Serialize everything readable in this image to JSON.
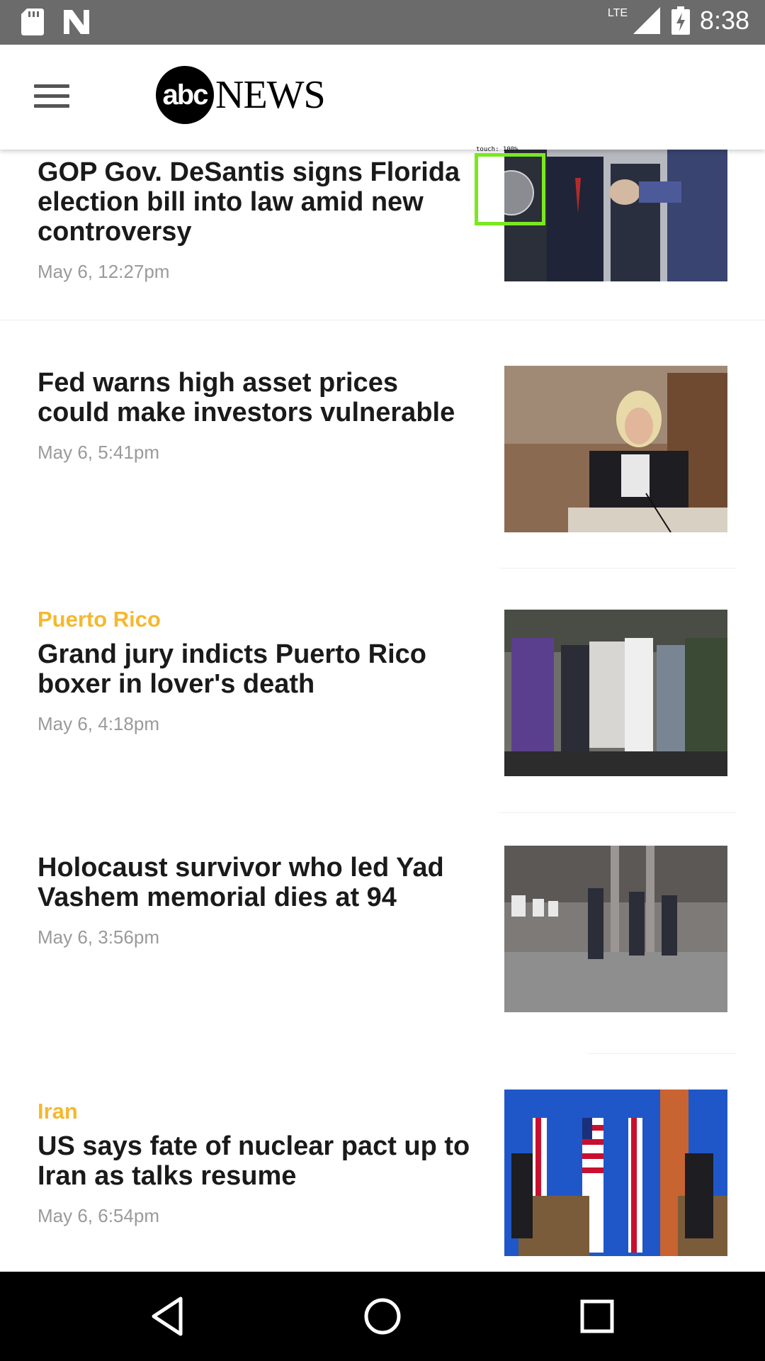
{
  "status_bar": {
    "time": "8:38",
    "network": "LTE",
    "icons": [
      "sd-card-icon",
      "n-logo-icon",
      "signal-icon",
      "battery-charging-icon"
    ]
  },
  "app_bar": {
    "logo_circle": "abc",
    "logo_word": "NEWS",
    "menu_icon": "hamburger-menu-icon"
  },
  "touch_indicator": {
    "label": "touch: 100%"
  },
  "articles": [
    {
      "category": "",
      "headline": "GOP Gov. DeSantis signs Florida election bill into law amid new controversy",
      "date": "May 6, 12:27pm",
      "image": "Men in suits at signing event"
    },
    {
      "category": "",
      "headline": "Fed warns high asset prices could make investors vulnerable",
      "date": "May 6, 5:41pm",
      "image": "Woman speaking at hearing table"
    },
    {
      "category": "Puerto Rico",
      "headline": "Grand jury indicts Puerto Rico boxer in lover's death",
      "date": "May 6, 4:18pm",
      "image": "Crowd of people embracing"
    },
    {
      "category": "",
      "headline": "Holocaust survivor who led Yad Vashem memorial dies at 94",
      "date": "May 6, 3:56pm",
      "image": "Men standing in empty building"
    },
    {
      "category": "Iran",
      "headline": "US says fate of nuclear pact up to Iran as talks resume",
      "date": "May 6, 6:54pm",
      "image": "Officials at podiums with flags"
    }
  ],
  "nav_bar": {
    "back": "back-triangle-icon",
    "home": "home-circle-icon",
    "recents": "recents-square-icon"
  },
  "colors": {
    "status_bar": "#6b6b6b",
    "category": "#f5b82e",
    "headline": "#1a1a1a",
    "date": "#9a9a9a",
    "touch_box": "#7be81f"
  }
}
